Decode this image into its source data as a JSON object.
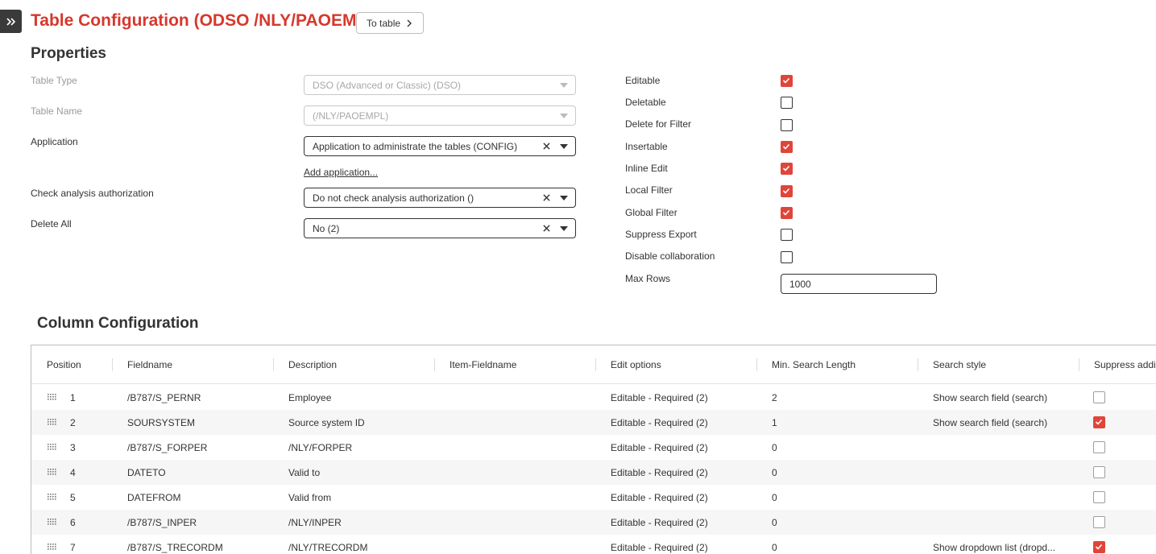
{
  "header": {
    "title": "Table Configuration (ODSO /NLY/PAOEMPL)",
    "to_table_label": "To table"
  },
  "properties": {
    "title": "Properties",
    "table_type": {
      "label": "Table Type",
      "value": "DSO (Advanced or Classic) (DSO)"
    },
    "table_name": {
      "label": "Table Name",
      "value": "(/NLY/PAOEMPL)"
    },
    "application": {
      "label": "Application",
      "value": "Application to administrate the tables (CONFIG)"
    },
    "add_application_label": "Add application...",
    "check_analysis": {
      "label": "Check analysis authorization",
      "value": "Do not check analysis authorization ()"
    },
    "delete_all": {
      "label": "Delete All",
      "value": "No (2)"
    },
    "flags": [
      {
        "label": "Editable",
        "checked": true
      },
      {
        "label": "Deletable",
        "checked": false
      },
      {
        "label": "Delete for Filter",
        "checked": false
      },
      {
        "label": "Insertable",
        "checked": true
      },
      {
        "label": "Inline Edit",
        "checked": true
      },
      {
        "label": "Local Filter",
        "checked": true
      },
      {
        "label": "Global Filter",
        "checked": true
      },
      {
        "label": "Suppress Export",
        "checked": false
      },
      {
        "label": "Disable collaboration",
        "checked": false
      }
    ],
    "max_rows": {
      "label": "Max Rows",
      "value": "1000"
    }
  },
  "columns": {
    "title": "Column Configuration",
    "headers": [
      "Position",
      "Fieldname",
      "Description",
      "Item-Fieldname",
      "Edit options",
      "Min. Search Length",
      "Search style",
      "Suppress addi"
    ],
    "rows": [
      {
        "position": "1",
        "fieldname": "/B787/S_PERNR",
        "description": "Employee",
        "item_fieldname": "",
        "edit_options": "Editable - Required (2)",
        "min_search": "2",
        "search_style": "Show search field (search)",
        "suppress": false
      },
      {
        "position": "2",
        "fieldname": "SOURSYSTEM",
        "description": "Source system ID",
        "item_fieldname": "",
        "edit_options": "Editable - Required (2)",
        "min_search": "1",
        "search_style": "Show search field (search)",
        "suppress": true
      },
      {
        "position": "3",
        "fieldname": "/B787/S_FORPER",
        "description": "/NLY/FORPER",
        "item_fieldname": "",
        "edit_options": "Editable - Required (2)",
        "min_search": "0",
        "search_style": "",
        "suppress": false
      },
      {
        "position": "4",
        "fieldname": "DATETO",
        "description": "Valid to",
        "item_fieldname": "",
        "edit_options": "Editable - Required (2)",
        "min_search": "0",
        "search_style": "",
        "suppress": false
      },
      {
        "position": "5",
        "fieldname": "DATEFROM",
        "description": "Valid from",
        "item_fieldname": "",
        "edit_options": "Editable - Required (2)",
        "min_search": "0",
        "search_style": "",
        "suppress": false
      },
      {
        "position": "6",
        "fieldname": "/B787/S_INPER",
        "description": "/NLY/INPER",
        "item_fieldname": "",
        "edit_options": "Editable - Required (2)",
        "min_search": "0",
        "search_style": "",
        "suppress": false
      },
      {
        "position": "7",
        "fieldname": "/B787/S_TRECORDM",
        "description": "/NLY/TRECORDM",
        "item_fieldname": "",
        "edit_options": "Editable - Required (2)",
        "min_search": "0",
        "search_style": "Show dropdown list (dropd...",
        "suppress": true
      }
    ]
  },
  "colors": {
    "accent": "#d6382d",
    "checkbox_checked": "#e0453a"
  }
}
